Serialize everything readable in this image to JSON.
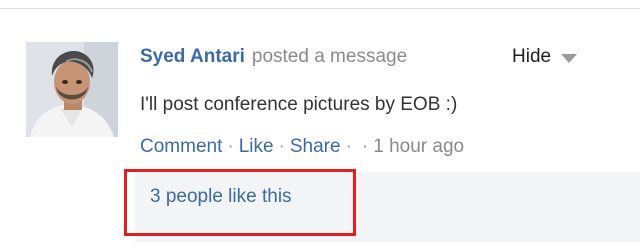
{
  "post": {
    "author": "Syed Antari",
    "action_text": "posted a message",
    "hide_label": "Hide",
    "message": "I'll post conference pictures by EOB :)",
    "actions": {
      "comment": "Comment",
      "like": "Like",
      "share": "Share",
      "separator": "·",
      "time": "1 hour ago"
    },
    "likes_text": "3 people like this"
  },
  "icons": {
    "hide_caret": "chevron-down-icon"
  },
  "colors": {
    "link": "#3b6aa6",
    "highlight_border": "#e02020",
    "likes_panel_bg": "#f3f4f6"
  }
}
